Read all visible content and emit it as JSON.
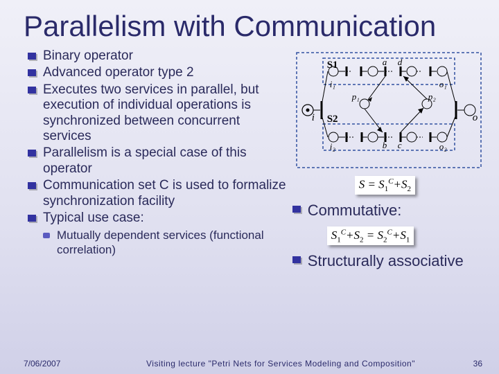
{
  "title": "Parallelism with Communication",
  "bullets": [
    "Binary operator",
    "Advanced operator type 2",
    "Executes two services in parallel, but execution of individual operations is synchronized between concurrent services",
    "Parallelism is a special case of this operator",
    "Communication set C is used to formalize synchronization facility",
    "Typical use case:"
  ],
  "sub_bullet": "Mutually dependent services (functional correlation)",
  "right": {
    "commutative": "Commutative:",
    "structurally": "Structurally associative"
  },
  "formula1": {
    "lhs": "S = S",
    "s1": "1",
    "mid": "+S",
    "s2": "2",
    "sup": "C"
  },
  "formula2": {
    "full": "S₁+S₂ = S₂+S₁",
    "sup": "C"
  },
  "diagram": {
    "s1_box": "S1",
    "s2_box": "S2",
    "a": "a",
    "d": "d",
    "b": "b",
    "c": "c",
    "i": "i",
    "o": "o",
    "i1": "i₁",
    "o1": "o₁",
    "i2": "i₂",
    "o2": "o₂",
    "p1": "p₁",
    "p2": "p₂"
  },
  "footer": {
    "date": "7/06/2007",
    "title": "Visiting lecture \"Petri Nets for Services Modeling and Composition\"",
    "page": "36"
  }
}
